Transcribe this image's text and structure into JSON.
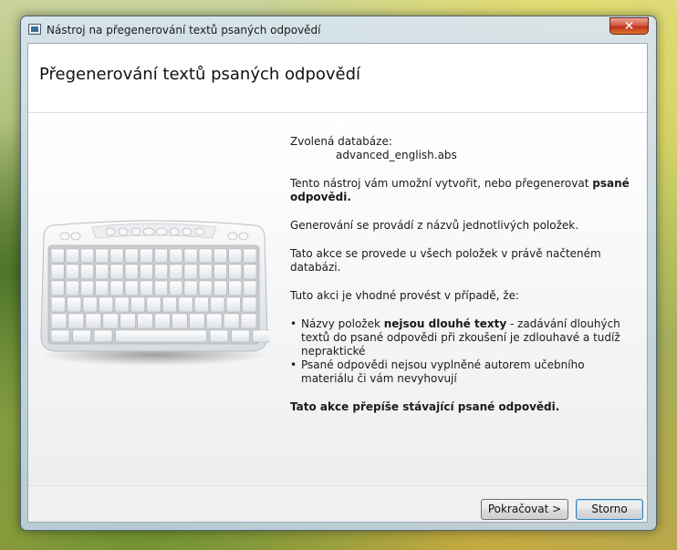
{
  "window": {
    "title": "Nástroj na přegenerování textů psaných odpovědí",
    "close_glyph": "✕"
  },
  "header": {
    "title": "Přegenerování textů psaných odpovědí"
  },
  "content": {
    "db_label": "Zvolená databáze:",
    "db_name": "advanced_english.abs",
    "intro_prefix": "Tento nástroj vám umožní vytvořit, nebo přegenerovat ",
    "intro_bold": "psané odpovědi.",
    "generation": "Generování se provádí z názvů jednotlivých položek.",
    "scope": "Tato akce se provede u všech položek v právě načteném databázi.",
    "when": "Tuto akci je vhodné provést v případě, že:",
    "bullet1_prefix": "Názvy položek ",
    "bullet1_bold": "nejsou dlouhé texty",
    "bullet1_suffix": " - zadávání dlouhých textů do psané odpovědi při zkoušení je zdlouhavé a tudíž nepraktické",
    "bullet2": "Psané odpovědi nejsou vyplněné autorem učebního materiálu či vám nevyhovují",
    "bullet_glyph": "•",
    "warning": "Tato akce přepíše stávající psané odpovědi."
  },
  "icons": {
    "keyboard": "keyboard-icon",
    "app": "app-icon"
  },
  "buttons": {
    "next": "Pokračovat >",
    "cancel": "Storno"
  }
}
